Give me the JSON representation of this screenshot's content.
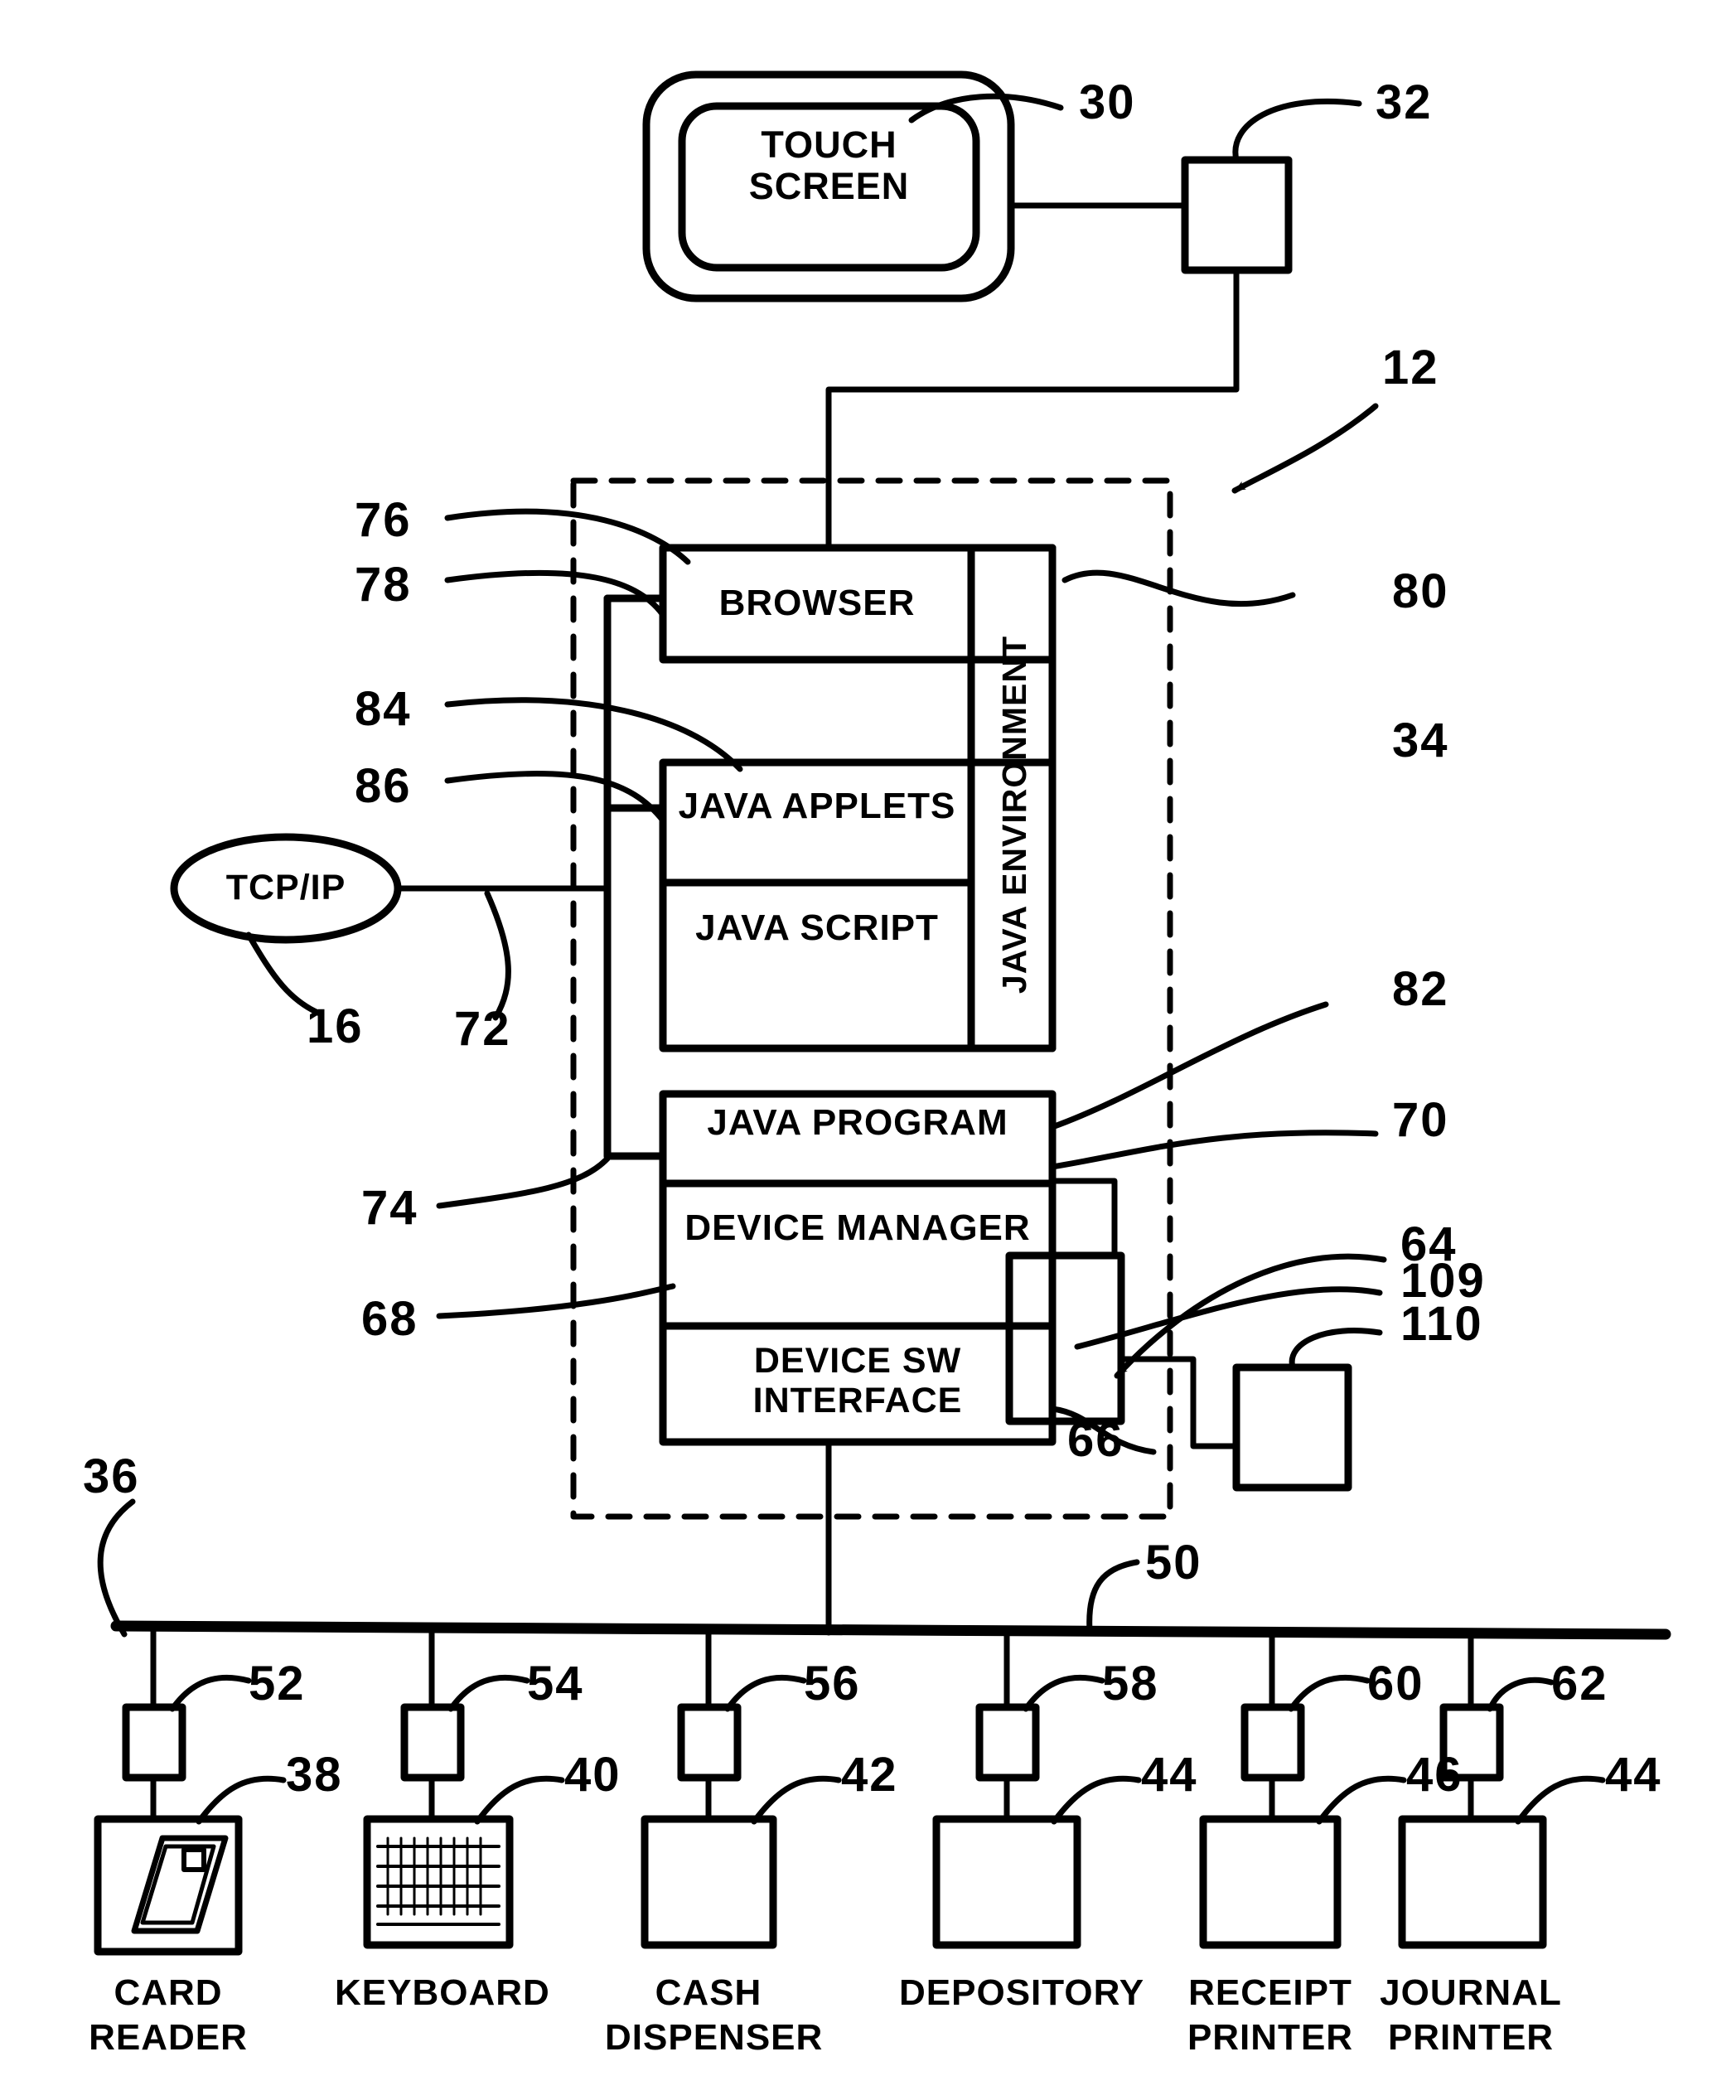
{
  "figure": {
    "type": "patent-block-diagram",
    "title": "ATM terminal Java/browser architecture block diagram"
  },
  "blocks": {
    "touch_screen": "TOUCH SCREEN",
    "browser": "BROWSER",
    "java_environment": "JAVA ENVIRONMENT",
    "java_applets": "JAVA APPLETS",
    "java_script": "JAVA SCRIPT",
    "java_program": "JAVA PROGRAM",
    "device_manager": "DEVICE MANAGER",
    "device_sw_interface": "DEVICE SW INTERFACE",
    "tcp_ip": "TCP/IP"
  },
  "devices": [
    {
      "label": "CARD READER",
      "connector_ref": "52",
      "device_ref": "38",
      "icon": "card-reader-icon"
    },
    {
      "label": "KEYBOARD",
      "connector_ref": "54",
      "device_ref": "40",
      "icon": "keyboard-icon"
    },
    {
      "label": "CASH DISPENSER",
      "connector_ref": "56",
      "device_ref": "42",
      "icon": "blank-box-icon"
    },
    {
      "label": "DEPOSITORY",
      "connector_ref": "58",
      "device_ref": "44",
      "icon": "blank-box-icon"
    },
    {
      "label": "RECEIPT PRINTER",
      "connector_ref": "60",
      "device_ref": "46",
      "icon": "blank-box-icon"
    },
    {
      "label": "JOURNAL PRINTER",
      "connector_ref": "62",
      "device_ref": "44",
      "icon": "blank-box-icon"
    }
  ],
  "reference_numerals": {
    "r12": "12",
    "r16": "16",
    "r30": "30",
    "r32": "32",
    "r34": "34",
    "r36": "36",
    "r50": "50",
    "r64": "64",
    "r66": "66",
    "r68": "68",
    "r70": "70",
    "r72": "72",
    "r74": "74",
    "r76": "76",
    "r78": "78",
    "r80": "80",
    "r82": "82",
    "r84": "84",
    "r86": "86",
    "r109": "109",
    "r110": "110"
  },
  "colors": {
    "ink": "#000000",
    "paper": "#ffffff"
  }
}
